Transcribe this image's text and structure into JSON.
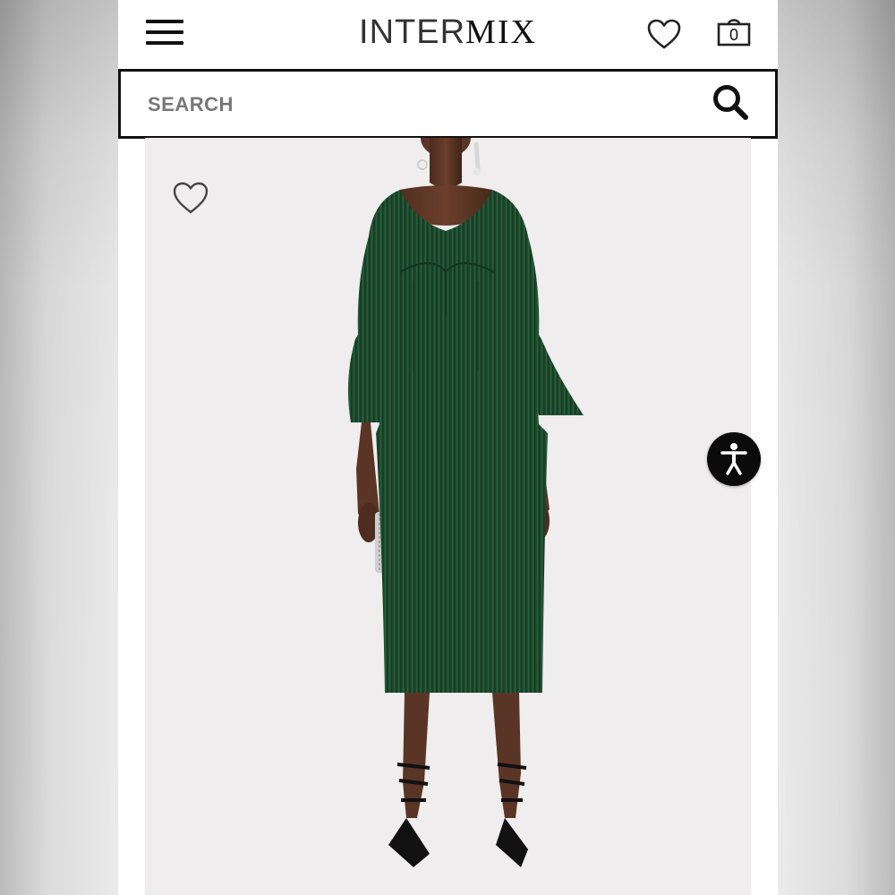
{
  "header": {
    "logo_light": "INTER",
    "logo_bold": "MIX",
    "bag_count": "0"
  },
  "search": {
    "placeholder": "SEARCH"
  },
  "icons": {
    "menu": "hamburger-menu-icon",
    "wishlist": "heart-outline-icon",
    "bag": "shopping-bag-icon",
    "search": "magnifier-icon",
    "favorite": "heart-outline-icon",
    "accessibility": "accessibility-person-icon"
  },
  "colors": {
    "brand_text": "#111111",
    "search_border": "#111111",
    "search_placeholder": "#777777",
    "dress": "#1d4a2c",
    "image_background": "#f0edee",
    "accessibility_button": "#0b0b0b"
  }
}
